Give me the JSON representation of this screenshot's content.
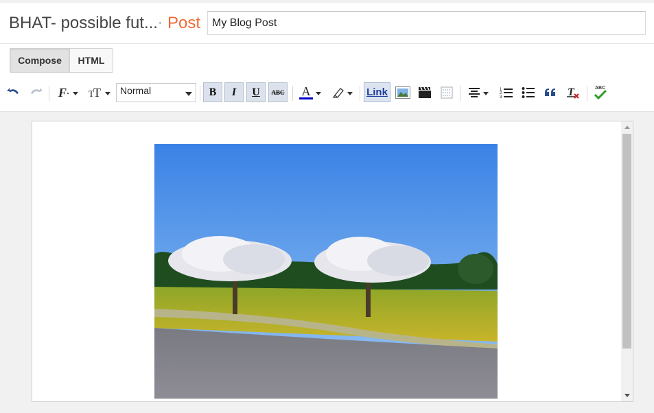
{
  "header": {
    "blog_name": "BHAT- possible fut...",
    "separator": "·",
    "section": "Post",
    "title_value": "My Blog Post"
  },
  "mode_tabs": {
    "compose": "Compose",
    "html": "HTML"
  },
  "toolbar": {
    "format_value": "Normal",
    "bold": "B",
    "italic": "I",
    "underline": "U",
    "strikethrough": "ABC",
    "link": "Link",
    "font_color": "A",
    "spell_check": "ABC"
  },
  "colors": {
    "accent": "#f06a35",
    "active_button_bg": "#dce2ed",
    "text_color_indicator": "#0000cc",
    "spellcheck_green": "#2a9d2a",
    "remove_format_red": "#cc2222"
  },
  "editor": {
    "image_alt": "Flowering trees on a grassy field beside a road"
  }
}
